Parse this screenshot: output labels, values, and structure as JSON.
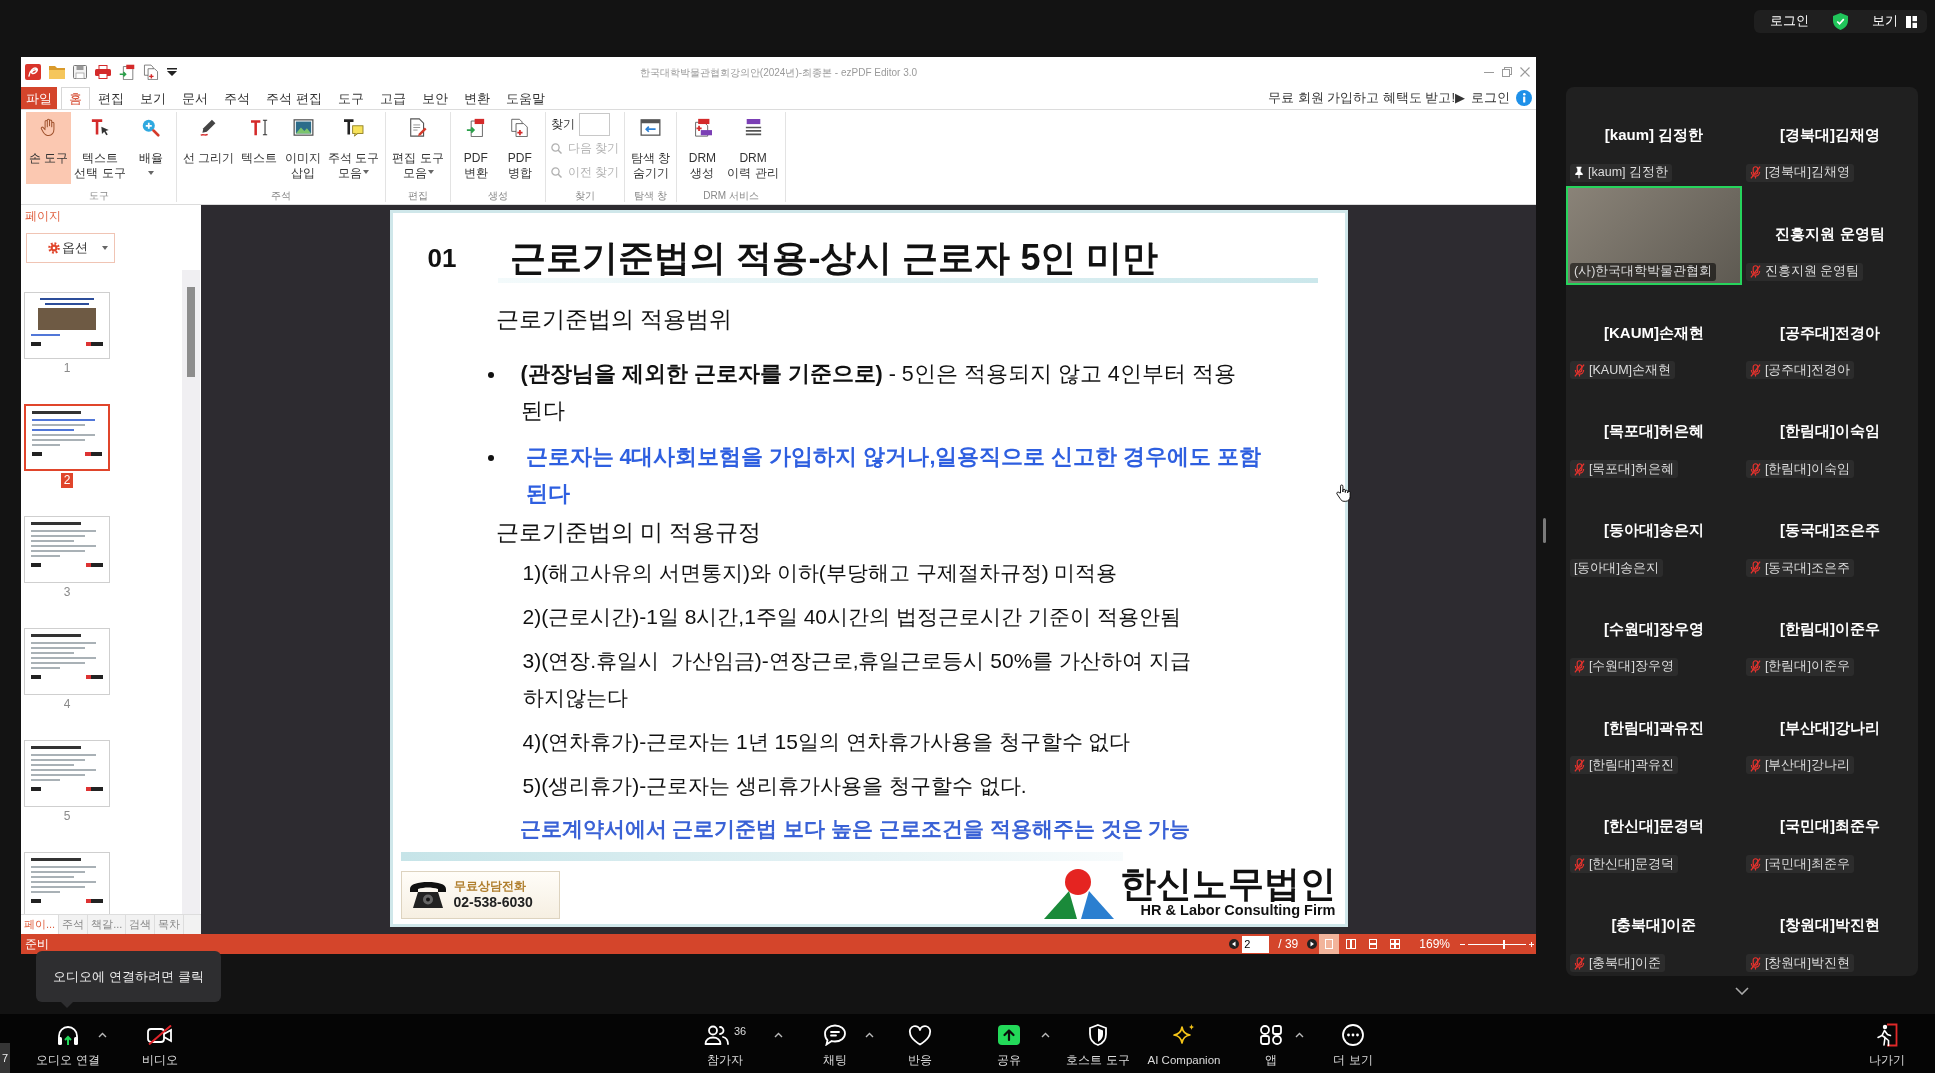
{
  "top_bar": {
    "login": "로그인",
    "view": "보기"
  },
  "editor": {
    "title": "한국대학박물관협회강의안(2024년)-최종본 - ezPDF Editor 3.0",
    "menu": [
      {
        "label": "파일",
        "kind": "file",
        "selected": false
      },
      {
        "label": "홈",
        "kind": "tab",
        "selected": true
      },
      {
        "label": "편집",
        "kind": "tab",
        "selected": false
      },
      {
        "label": "보기",
        "kind": "tab",
        "selected": false
      },
      {
        "label": "문서",
        "kind": "tab",
        "selected": false
      },
      {
        "label": "주석",
        "kind": "tab",
        "selected": false
      },
      {
        "label": "주석 편집",
        "kind": "tab",
        "selected": false
      },
      {
        "label": "도구",
        "kind": "tab",
        "selected": false
      },
      {
        "label": "고급",
        "kind": "tab",
        "selected": false
      },
      {
        "label": "보안",
        "kind": "tab",
        "selected": false
      },
      {
        "label": "변환",
        "kind": "tab",
        "selected": false
      },
      {
        "label": "도움말",
        "kind": "tab",
        "selected": false
      }
    ],
    "promo": "무료 회원 가입하고 혜택도 받고!▶",
    "login": "로그인",
    "ribbon": [
      {
        "label": "도구",
        "kind": "buttons",
        "buttons": [
          {
            "label": "손 도구",
            "selected": true,
            "dropdown": false
          },
          {
            "label": "텍스트\n선택 도구",
            "selected": false,
            "dropdown": false
          },
          {
            "label": "배율",
            "selected": false,
            "dropdown": true
          }
        ]
      },
      {
        "label": "주석",
        "kind": "buttons",
        "buttons": [
          {
            "label": "선 그리기",
            "selected": false,
            "dropdown": false
          },
          {
            "label": "텍스트",
            "selected": false,
            "dropdown": false
          },
          {
            "label": "이미지\n삽입",
            "selected": false,
            "dropdown": false
          },
          {
            "label": "주석 도구\n모음",
            "selected": false,
            "dropdown": true
          }
        ]
      },
      {
        "label": "편집",
        "kind": "buttons",
        "buttons": [
          {
            "label": "편집 도구\n모음",
            "selected": false,
            "dropdown": true
          }
        ]
      },
      {
        "label": "생성",
        "kind": "buttons",
        "buttons": [
          {
            "label": "PDF\n변환",
            "selected": false,
            "dropdown": false
          },
          {
            "label": "PDF\n병합",
            "selected": false,
            "dropdown": false
          }
        ]
      },
      {
        "label": "찾기",
        "kind": "find",
        "find_label": "찾기",
        "next": "다음 찾기",
        "prev": "이전 찾기",
        "disabled": true
      },
      {
        "label": "탐색 창",
        "kind": "buttons",
        "buttons": [
          {
            "label": "탐색 창\n숨기기",
            "selected": false,
            "dropdown": false
          }
        ]
      },
      {
        "label": "DRM 서비스",
        "kind": "buttons",
        "buttons": [
          {
            "label": "DRM\n생성",
            "selected": false,
            "dropdown": false
          },
          {
            "label": "DRM\n이력 관리",
            "selected": false,
            "dropdown": false
          }
        ]
      }
    ],
    "panel": {
      "title": "페이지",
      "options": "옵션",
      "thumbnails": [
        {
          "number": "1",
          "selected": false
        },
        {
          "number": "2",
          "selected": true
        },
        {
          "number": "3",
          "selected": false
        },
        {
          "number": "4",
          "selected": false
        },
        {
          "number": "5",
          "selected": false
        },
        {
          "selected": false
        }
      ],
      "tabs": [
        {
          "label": "페이...",
          "selected": true
        },
        {
          "label": "주석",
          "selected": false
        },
        {
          "label": "책갈...",
          "selected": false
        },
        {
          "label": "검색",
          "selected": false
        },
        {
          "label": "목차",
          "selected": false
        }
      ]
    },
    "slide": {
      "number": "01",
      "title": "근로기준법의 적용-상시 근로자 5인 미만",
      "blocks": [
        {
          "kind": "heading",
          "text": "근로기준법의 적용범위"
        },
        {
          "kind": "bullet",
          "text": "**(관장님을 제외한 근로자를 기준으로)** - 5인은 적용되지 않고 4인부터 적용 된다"
        },
        {
          "kind": "bullet_blue",
          "text": "근로자는 4대사회보험을 가입하지 않거나,일용직으로 신고한 경우에도 포함 된다"
        },
        {
          "kind": "heading",
          "text": "근로기준법의 미 적용규정"
        },
        {
          "kind": "item",
          "text": "1)(해고사유의 서면통지)와 이하(부당해고 구제절차규정) 미적용"
        },
        {
          "kind": "item",
          "text": "2)(근로시간)-1일 8시간,1주일 40시간의 법정근로시간 기준이 적용안됨"
        },
        {
          "kind": "item",
          "text": "3)(연장.휴일시  가산임금)-연장근로,휴일근로등시 50%를 가산하여 지급 하지않는다"
        },
        {
          "kind": "item",
          "text": "4)(연차휴가)-근로자는 1년 15일의 연차휴가사용을 청구할수 없다"
        },
        {
          "kind": "item",
          "text": "5)(생리휴가)-근로자는 생리휴가사용을 청구할수 없다."
        },
        {
          "kind": "note",
          "text": "근로계약서에서 근로기준법 보다 높은 근로조건을 적용해주는 것은 가능"
        }
      ],
      "phone_label": "무료상담전화",
      "phone": "02-538-6030",
      "firm": "한신노무법인",
      "firm_en": "HR & Labor Consulting Firm"
    },
    "status_bar": {
      "text": "준비",
      "page": "2",
      "total": "/ 39",
      "views": [
        {
          "selected": true
        },
        {
          "selected": false
        },
        {
          "selected": false
        },
        {
          "selected": false
        }
      ],
      "zoom": "169%",
      "zoom_slider": {
        "level": 0.62
      }
    }
  },
  "video_tile": {
    "label": "(사)한국대학박물관협회",
    "speaking": true
  },
  "participants": [
    {
      "name": "[kaum] 김정한",
      "label": "[kaum] 김정한",
      "muted": false,
      "pinned": true,
      "speaking": false
    },
    {
      "name": "[경북대]김채영",
      "label": "[경북대]김채영",
      "muted": true,
      "pinned": false,
      "speaking": false
    },
    {
      "name": "진흥지원 운영팀",
      "label": "진흥지원 운영팀",
      "muted": true,
      "pinned": false,
      "speaking": false
    },
    {
      "name": "[KAUM]손재현",
      "label": "[KAUM]손재현",
      "muted": true,
      "pinned": false,
      "speaking": false
    },
    {
      "name": "[공주대]전경아",
      "label": "[공주대]전경아",
      "muted": true,
      "pinned": false,
      "speaking": false
    },
    {
      "name": "[목포대]허은혜",
      "label": "[목포대]허은혜",
      "muted": true,
      "pinned": false,
      "speaking": false
    },
    {
      "name": "[한림대]이숙임",
      "label": "[한림대]이숙임",
      "muted": true,
      "pinned": false,
      "speaking": false
    },
    {
      "name": "[동아대]송은지",
      "label": "[동아대]송은지",
      "muted": false,
      "pinned": false,
      "speaking": false
    },
    {
      "name": "[동국대]조은주",
      "label": "[동국대]조은주",
      "muted": true,
      "pinned": false,
      "speaking": false
    },
    {
      "name": "[수원대]장우영",
      "label": "[수원대]장우영",
      "muted": true,
      "pinned": false,
      "speaking": false
    },
    {
      "name": "[한림대]이준우",
      "label": "[한림대]이준우",
      "muted": true,
      "pinned": false,
      "speaking": false
    },
    {
      "name": "[한림대]곽유진",
      "label": "[한림대]곽유진",
      "muted": true,
      "pinned": false,
      "speaking": false
    },
    {
      "name": "[부산대]강나리",
      "label": "[부산대]강나리",
      "muted": true,
      "pinned": false,
      "speaking": false
    },
    {
      "name": "[한신대]문경덕",
      "label": "[한신대]문경덕",
      "muted": true,
      "pinned": false,
      "speaking": false
    },
    {
      "name": "[국민대]최준우",
      "label": "[국민대]최준우",
      "muted": true,
      "pinned": false,
      "speaking": false
    },
    {
      "name": "[충북대]이준",
      "label": "[충북대]이준",
      "muted": true,
      "pinned": false,
      "speaking": false
    },
    {
      "name": "[창원대]박진현",
      "label": "[창원대]박진현",
      "muted": true,
      "pinned": false,
      "speaking": false
    }
  ],
  "tooltip": "오디오에 연결하려면 클릭",
  "toolbar": {
    "edge_label": "7",
    "audio": {
      "label": "오디오 연결",
      "caret": true
    },
    "video": {
      "label": "비디오",
      "on": false
    },
    "items": [
      {
        "label": "참가자",
        "count": "36",
        "caret": true
      },
      {
        "label": "채팅",
        "caret": true
      },
      {
        "label": "반응",
        "caret": false
      },
      {
        "label": "공유",
        "caret": true
      },
      {
        "label": "호스트 도구",
        "caret": false
      },
      {
        "label": "AI Companion",
        "caret": false
      },
      {
        "label": "앱",
        "caret": true
      },
      {
        "label": "더 보기",
        "caret": false
      }
    ],
    "leave": "나가기"
  }
}
